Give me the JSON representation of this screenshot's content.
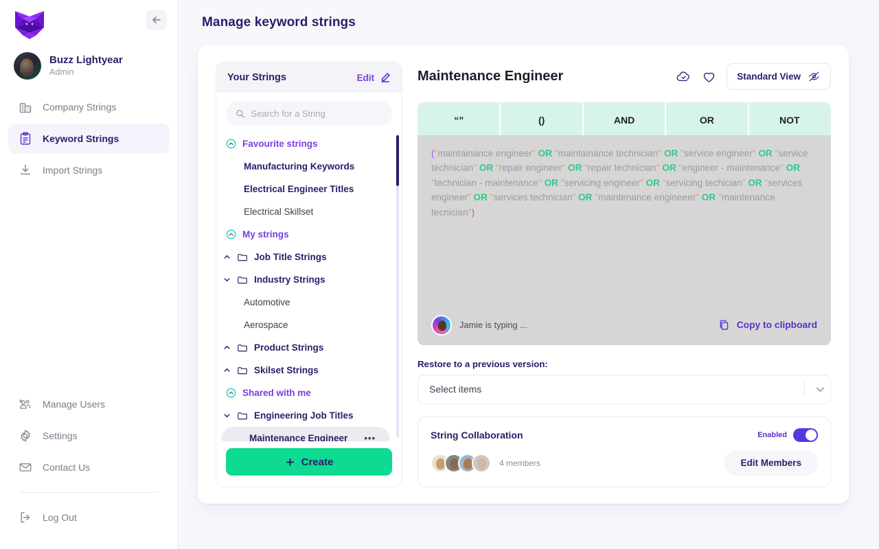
{
  "sidebar": {
    "logo_icon": "fox-logo-icon",
    "collapse_icon": "arrow-left-icon",
    "user": {
      "name": "Buzz Lightyear",
      "role": "Admin"
    },
    "nav_items": [
      {
        "label": "Company Strings",
        "icon": "building-icon",
        "active": false
      },
      {
        "label": "Keyword Strings",
        "icon": "clipboard-icon",
        "active": true
      },
      {
        "label": "Import Strings",
        "icon": "download-icon",
        "active": false
      }
    ],
    "bottom_items": [
      {
        "label": "Manage Users",
        "icon": "users-icon"
      },
      {
        "label": "Settings",
        "icon": "gear-icon"
      },
      {
        "label": "Contact Us",
        "icon": "envelope-icon"
      }
    ],
    "logout": {
      "label": "Log Out",
      "icon": "logout-icon"
    }
  },
  "header": {
    "title": "Manage keyword strings"
  },
  "strings_panel": {
    "title": "Your Strings",
    "edit_label": "Edit",
    "edit_icon": "pencil-icon",
    "search": {
      "placeholder": "Search for a String",
      "value": "",
      "icon": "search-icon"
    },
    "tree": [
      {
        "label": "Favourite strings",
        "type": "group",
        "icon": "circle-chevron-up-icon"
      },
      {
        "label": "Manufacturing Keywords",
        "type": "leaf-fav"
      },
      {
        "label": "Electrical Engineer Titles",
        "type": "leaf-fav"
      },
      {
        "label": "Electrical Skillset",
        "type": "leaf"
      },
      {
        "label": "My strings",
        "type": "group",
        "icon": "circle-chevron-up-icon"
      },
      {
        "label": "Job Title Strings",
        "type": "folder",
        "chevron": "chevron-up-icon"
      },
      {
        "label": "Industry Strings",
        "type": "folder",
        "chevron": "chevron-down-icon"
      },
      {
        "label": "Automotive",
        "type": "leaf"
      },
      {
        "label": "Aerospace",
        "type": "leaf"
      },
      {
        "label": "Product Strings",
        "type": "folder",
        "chevron": "chevron-up-icon"
      },
      {
        "label": "Skilset Strings",
        "type": "folder",
        "chevron": "chevron-up-icon"
      },
      {
        "label": "Shared with me",
        "type": "group",
        "icon": "circle-chevron-up-icon"
      },
      {
        "label": "Engineering Job Titles",
        "type": "folder",
        "chevron": "chevron-down-icon"
      },
      {
        "label": "Maintenance Engineer",
        "type": "leaf-selected",
        "menu": "•••"
      }
    ],
    "create_label": "Create",
    "create_icon": "plus-icon"
  },
  "editor": {
    "title": "Maintenance Engineer",
    "save_icon": "cloud-check-icon",
    "favourite_icon": "heart-icon",
    "view_button": {
      "label": "Standard View",
      "icon": "eye-off-icon"
    },
    "operator_tabs": [
      {
        "label": "“”",
        "name": "quotes"
      },
      {
        "label": "()",
        "name": "parentheses"
      },
      {
        "label": "AND",
        "name": "and"
      },
      {
        "label": "OR",
        "name": "or"
      },
      {
        "label": "NOT",
        "name": "not"
      }
    ],
    "string_tokens": [
      {
        "t": "(",
        "k": "paren"
      },
      {
        "t": "\"",
        "k": "q"
      },
      {
        "t": "maintainance engineer",
        "k": "w"
      },
      {
        "t": "\"",
        "k": "q"
      },
      {
        "t": " OR ",
        "k": "op"
      },
      {
        "t": "\"",
        "k": "q"
      },
      {
        "t": "maintainance technician",
        "k": "w"
      },
      {
        "t": "\"",
        "k": "q"
      },
      {
        "t": " OR ",
        "k": "op"
      },
      {
        "t": "\"",
        "k": "q"
      },
      {
        "t": "service engineer",
        "k": "w"
      },
      {
        "t": "\"",
        "k": "q"
      },
      {
        "t": " OR ",
        "k": "op"
      },
      {
        "t": "\"",
        "k": "q"
      },
      {
        "t": "service technician",
        "k": "w"
      },
      {
        "t": "\"",
        "k": "q"
      },
      {
        "t": " OR ",
        "k": "op"
      },
      {
        "t": "\"",
        "k": "q"
      },
      {
        "t": "repair engineer",
        "k": "w"
      },
      {
        "t": "\"",
        "k": "q"
      },
      {
        "t": " OR ",
        "k": "op"
      },
      {
        "t": "\"",
        "k": "q"
      },
      {
        "t": "repair technician",
        "k": "w"
      },
      {
        "t": "\"",
        "k": "q"
      },
      {
        "t": " OR ",
        "k": "op"
      },
      {
        "t": "\"",
        "k": "q"
      },
      {
        "t": "engineer - maintenance",
        "k": "w"
      },
      {
        "t": "\"",
        "k": "q"
      },
      {
        "t": " OR ",
        "k": "op"
      },
      {
        "t": "\"",
        "k": "q"
      },
      {
        "t": "technician - maintenance",
        "k": "w"
      },
      {
        "t": "\"",
        "k": "q"
      },
      {
        "t": " OR ",
        "k": "op"
      },
      {
        "t": "\"",
        "k": "q"
      },
      {
        "t": "servicing engineer",
        "k": "w"
      },
      {
        "t": "\"",
        "k": "q"
      },
      {
        "t": " OR ",
        "k": "op"
      },
      {
        "t": "\"",
        "k": "q"
      },
      {
        "t": "servicing techician",
        "k": "w"
      },
      {
        "t": "\"",
        "k": "q"
      },
      {
        "t": " OR ",
        "k": "op"
      },
      {
        "t": "\"",
        "k": "q"
      },
      {
        "t": "services engineer",
        "k": "w"
      },
      {
        "t": "\"",
        "k": "q"
      },
      {
        "t": " OR ",
        "k": "op"
      },
      {
        "t": "\"",
        "k": "q"
      },
      {
        "t": "services technician",
        "k": "w"
      },
      {
        "t": "\"",
        "k": "q"
      },
      {
        "t": " OR ",
        "k": "op"
      },
      {
        "t": "\"",
        "k": "q"
      },
      {
        "t": "maintenance engineeer",
        "k": "w"
      },
      {
        "t": "\"",
        "k": "q"
      },
      {
        "t": " OR ",
        "k": "op"
      },
      {
        "t": "\"",
        "k": "q"
      },
      {
        "t": "maintenance tecnician",
        "k": "w"
      },
      {
        "t": "\"",
        "k": "q"
      },
      {
        "t": ")",
        "k": "paren"
      }
    ],
    "typing_status": "Jamie is typing ...",
    "copy_label": "Copy to clipboard",
    "copy_icon": "copy-icon",
    "restore_label": "Restore to a previous version:",
    "restore_select": {
      "value": "Select items",
      "icon": "chevron-down-icon"
    },
    "collaboration": {
      "title": "String Collaboration",
      "toggle_label": "Enabled",
      "toggle_on": true,
      "member_count": "4 members",
      "edit_members_label": "Edit Members"
    }
  },
  "colors": {
    "brand_purple": "#2d1b69",
    "accent_violet": "#7a3ee0",
    "mint": "#d6f5e8",
    "green": "#0ddb92",
    "toggle_blue": "#4f3ae0",
    "quote_orange": "#e8a24a",
    "operator_green": "#2fc98c"
  }
}
